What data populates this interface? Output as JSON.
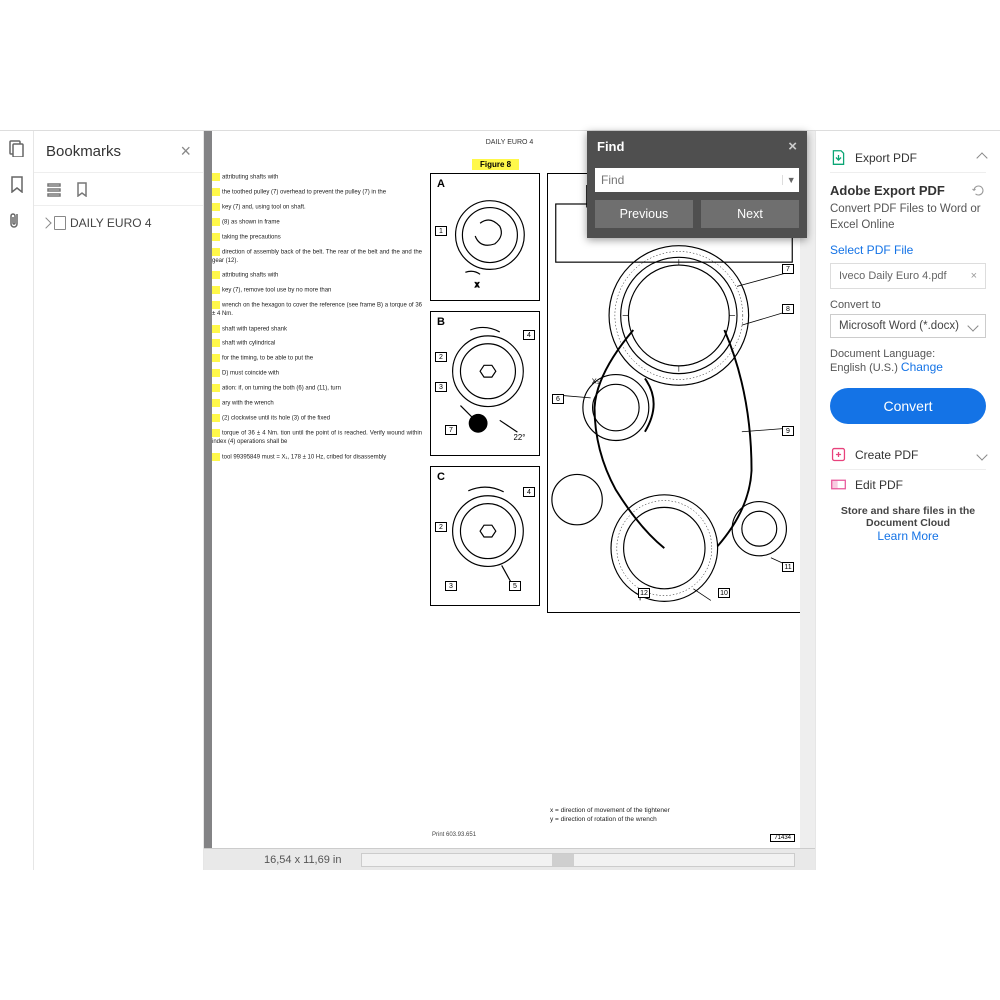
{
  "bookmarks": {
    "title": "Bookmarks",
    "item": "DAILY EURO 4"
  },
  "page": {
    "header": "DAILY EURO 4",
    "figure": "Figure 8",
    "text": [
      "attributing shafts with",
      "the toothed pulley (7) overhead to prevent the pulley (7) in the",
      "key (7) and, using tool on shaft.",
      "(8) as shown in frame",
      "taking the precautions",
      "direction of assembly back of the belt. The rear of the belt and the and the gear (12).",
      "attributing shafts with",
      "key (7), remove tool use by no more than",
      "wrench on the hexagon to cover the reference (see frame B) a torque of 36 ± 4 Nm.",
      "shaft with tapered shank",
      "shaft with cylindrical",
      "for the timing, to be able to put the",
      "D) must coincide with",
      "ation: if, on turning the both (6) and (11), turn",
      "ary with the wrench",
      "(2) clockwise until its hole (3) of the fixed",
      "torque of 36 ± 4 Nm. tion until the point of is reached. Verify wound within index (4) operations shall be",
      "tool 99395849 must = X₁, 178 ± 10 Hz, cribed for disassembly"
    ],
    "caption_x": "x = direction of movement of the tightener",
    "caption_y": "y = direction of rotation of the wrench",
    "footnote": "Print 603.93.651",
    "pagenum": "71434"
  },
  "status": {
    "dimensions": "16,54 x 11,69 in"
  },
  "find": {
    "title": "Find",
    "placeholder": "Find",
    "prev": "Previous",
    "next": "Next"
  },
  "rpanel": {
    "export": "Export PDF",
    "subtitle": "Adobe Export PDF",
    "desc": "Convert PDF Files to Word or Excel Online",
    "select_label": "Select PDF File",
    "filename": "Iveco Daily Euro 4.pdf",
    "convert_to": "Convert to",
    "format": "Microsoft Word (*.docx)",
    "lang_label": "Document Language:",
    "lang_value": "English (U.S.)",
    "change": "Change",
    "convert_btn": "Convert",
    "create": "Create PDF",
    "edit": "Edit PDF",
    "cloud_title": "Store and share files in the Document Cloud",
    "learn": "Learn More"
  }
}
